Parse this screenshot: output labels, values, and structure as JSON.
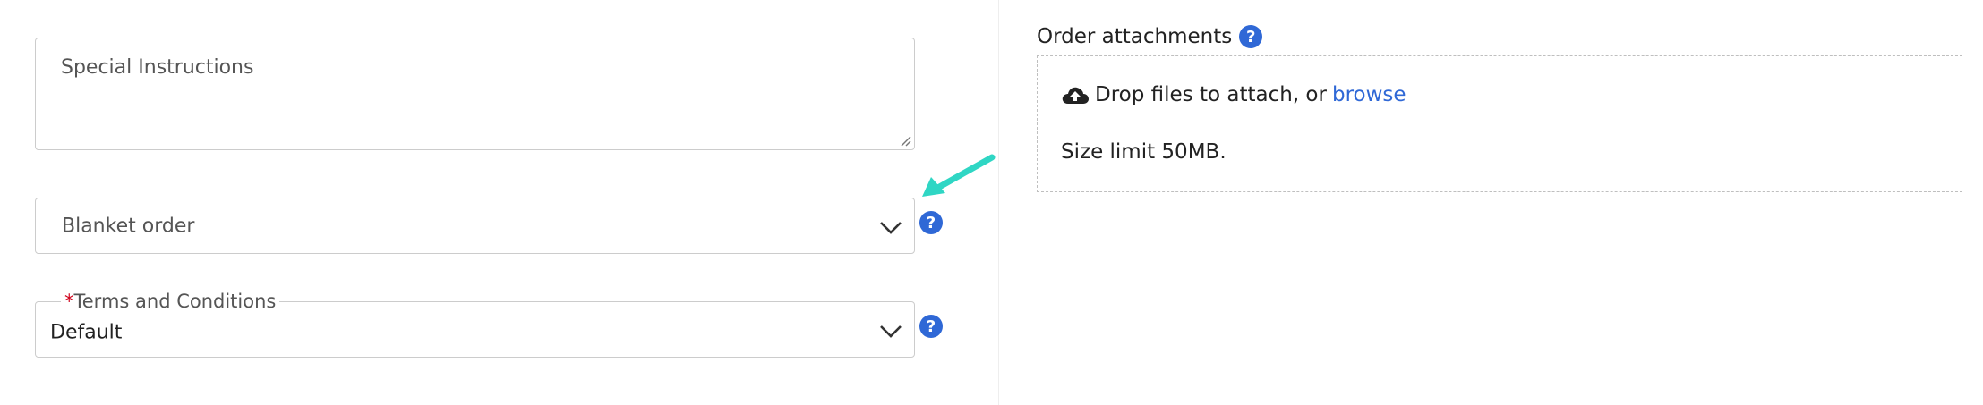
{
  "special_instructions": {
    "placeholder": "Special Instructions",
    "value": ""
  },
  "blanket_order": {
    "value": "Blanket order",
    "icon": "chevron-down-icon",
    "help_icon": "question-icon"
  },
  "terms_conditions": {
    "required_mark": "*",
    "label": "Terms and Conditions",
    "value": "Default",
    "icon": "chevron-down-icon",
    "help_icon": "question-icon"
  },
  "attachments": {
    "title": "Order attachments",
    "drop_text": "Drop files to attach, or",
    "browse_label": "browse",
    "size_limit": "Size limit 50MB.",
    "icon": "cloud-upload-icon"
  },
  "colors": {
    "accent": "#2f68d6",
    "required": "#d0021b",
    "annotation_arrow": "#2fd6c4"
  }
}
